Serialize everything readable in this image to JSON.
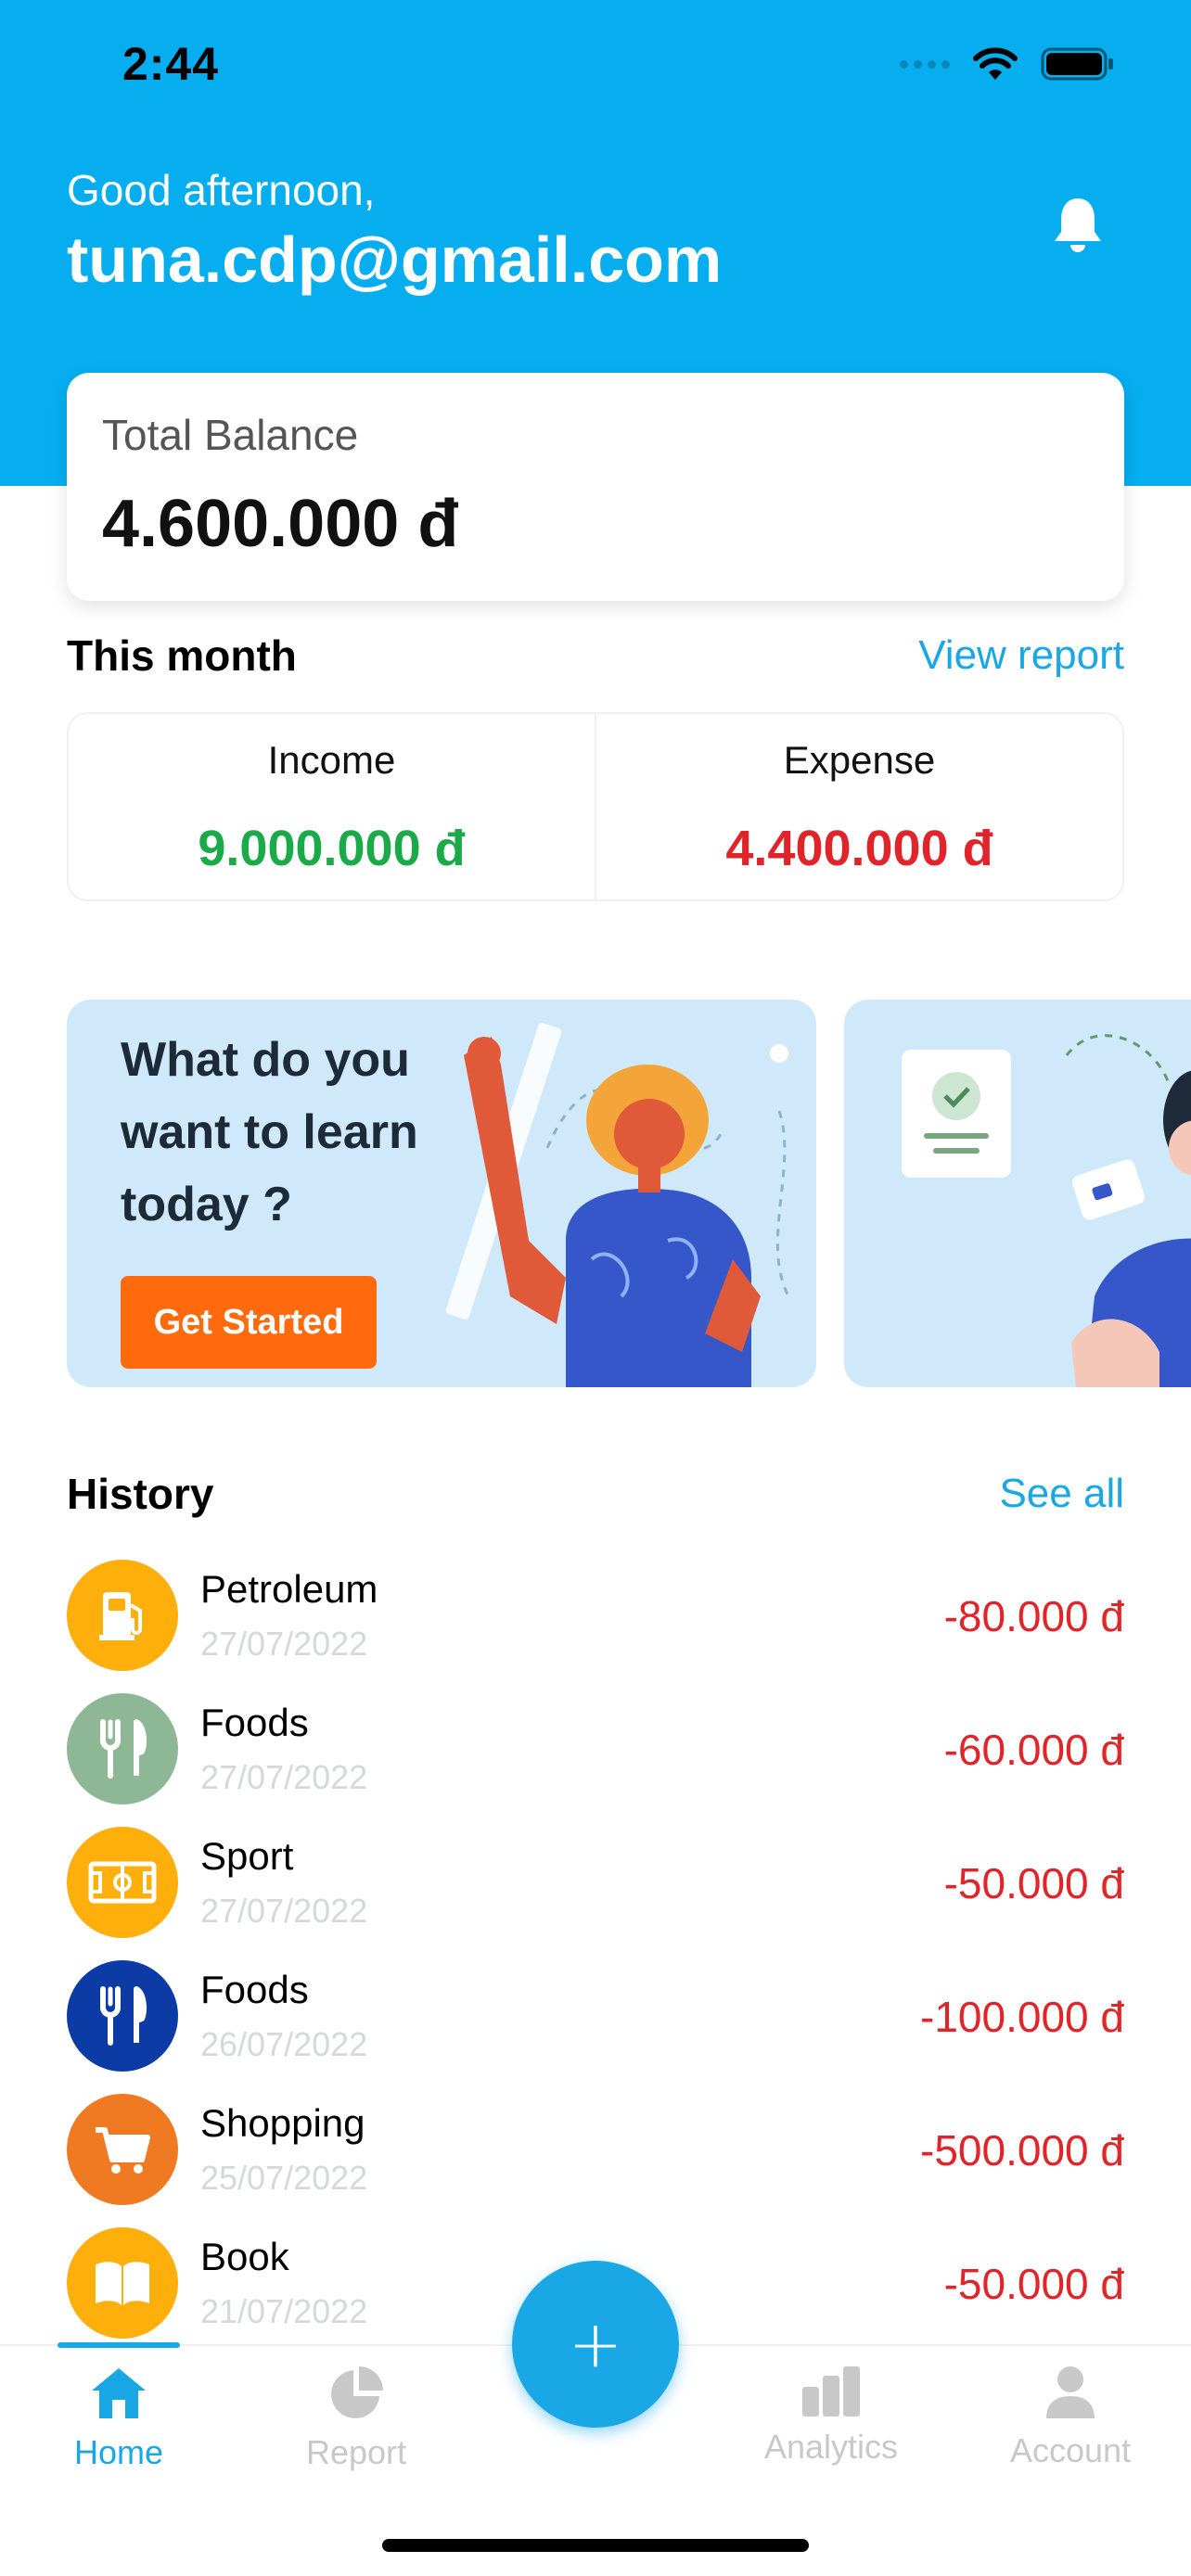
{
  "status_bar": {
    "time": "2:44"
  },
  "header": {
    "greeting": "Good afternoon,",
    "email": "tuna.cdp@gmail.com"
  },
  "balance": {
    "label": "Total Balance",
    "value": "4.600.000 đ"
  },
  "month": {
    "title": "This month",
    "link": "View report",
    "income_label": "Income",
    "income_value": "9.000.000 đ",
    "expense_label": "Expense",
    "expense_value": "4.400.000 đ"
  },
  "banner": {
    "text": "What do you want to learn today ?",
    "button": "Get Started"
  },
  "history": {
    "title": "History",
    "link": "See all",
    "items": [
      {
        "name": "Petroleum",
        "date": "27/07/2022",
        "amount": "-80.000 đ",
        "icon": "gas-pump-icon",
        "color": "#FFAF0C"
      },
      {
        "name": "Foods",
        "date": "27/07/2022",
        "amount": "-60.000 đ",
        "icon": "fork-knife-icon",
        "color": "#8EB796"
      },
      {
        "name": "Sport",
        "date": "27/07/2022",
        "amount": "-50.000 đ",
        "icon": "sport-field-icon",
        "color": "#FFAF0C"
      },
      {
        "name": "Foods",
        "date": "26/07/2022",
        "amount": "-100.000 đ",
        "icon": "fork-knife-icon",
        "color": "#0D3BA6"
      },
      {
        "name": "Shopping",
        "date": "25/07/2022",
        "amount": "-500.000 đ",
        "icon": "cart-icon",
        "color": "#F07A22"
      },
      {
        "name": "Book",
        "date": "21/07/2022",
        "amount": "-50.000 đ",
        "icon": "book-icon",
        "color": "#FFAF0C"
      }
    ]
  },
  "tabs": [
    {
      "label": "Home",
      "icon": "home-icon",
      "active": true
    },
    {
      "label": "Report",
      "icon": "pie-chart-icon",
      "active": false
    },
    {
      "label": "Analytics",
      "icon": "bar-chart-icon",
      "active": false
    },
    {
      "label": "Account",
      "icon": "user-icon",
      "active": false
    }
  ],
  "fab": {
    "label": "+"
  },
  "colors": {
    "primary": "#06AEEF",
    "income": "#1BAA48",
    "expense": "#E0242A",
    "cta": "#FF6A0D"
  }
}
